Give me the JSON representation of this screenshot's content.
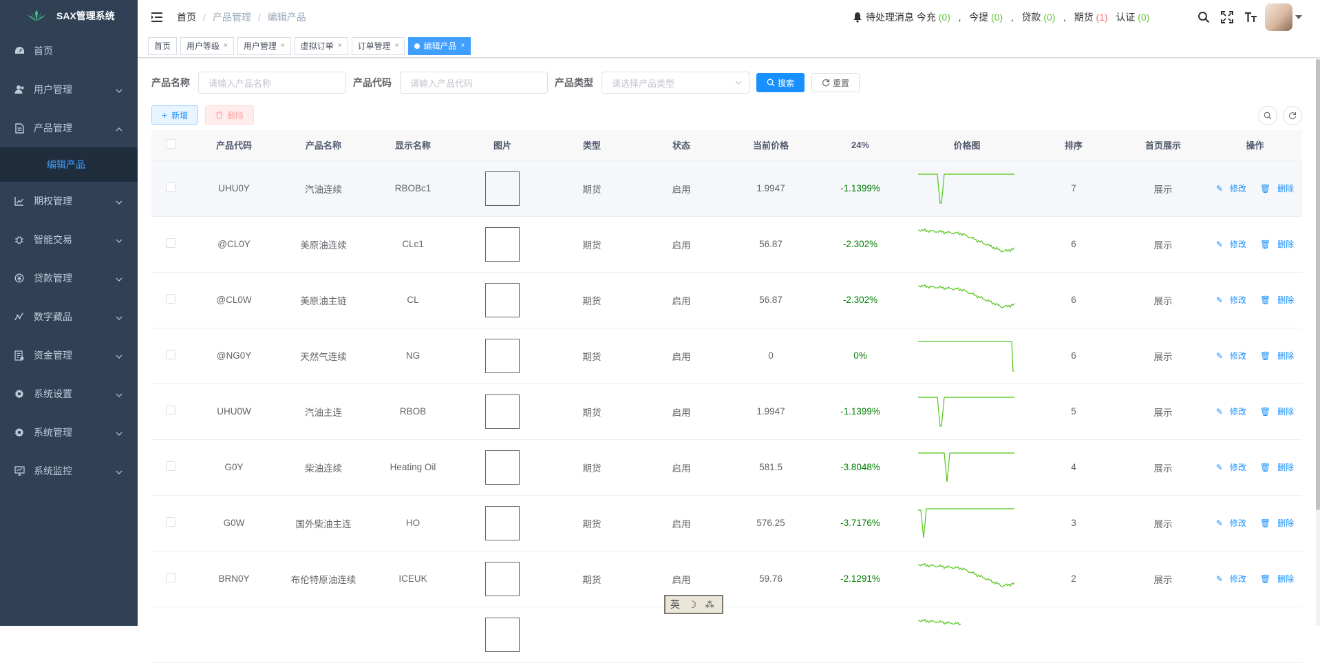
{
  "app": {
    "title": "SAX管理系统"
  },
  "sidebar": {
    "items": [
      {
        "label": "首页",
        "icon": "dashboard-icon"
      },
      {
        "label": "用户管理",
        "icon": "user-icon"
      },
      {
        "label": "产品管理",
        "icon": "document-icon",
        "expanded": true
      },
      {
        "label": "期权管理",
        "icon": "chart-icon"
      },
      {
        "label": "智能交易",
        "icon": "bug-icon"
      },
      {
        "label": "贷款管理",
        "icon": "money-icon"
      },
      {
        "label": "数字藏品",
        "icon": "trend-icon"
      },
      {
        "label": "资金管理",
        "icon": "ledger-icon"
      },
      {
        "label": "系统设置",
        "icon": "gear-icon"
      },
      {
        "label": "系统管理",
        "icon": "gear-icon"
      },
      {
        "label": "系统监控",
        "icon": "monitor-icon"
      }
    ],
    "sub_item": "编辑产品"
  },
  "navbar": {
    "breadcrumb": [
      "首页",
      "产品管理",
      "编辑产品"
    ],
    "notice": {
      "label": "待处理消息",
      "recharge_label": "今充",
      "recharge_count": "(0)",
      "withdraw_label": "今提",
      "withdraw_count": "(0)",
      "loan_label": "贷款",
      "loan_count": "(0)",
      "futures_label": "期货",
      "futures_count": "(1)",
      "verify_label": "认证",
      "verify_count": "(0)",
      "comma": ","
    }
  },
  "tags": [
    "首页",
    "用户等级",
    "用户管理",
    "虚拟订单",
    "订单管理",
    "编辑产品"
  ],
  "search_form": {
    "name_label": "产品名称",
    "name_placeholder": "请输入产品名称",
    "code_label": "产品代码",
    "code_placeholder": "请输入产品代码",
    "type_label": "产品类型",
    "type_placeholder": "请选择产品类型",
    "search_btn": "搜索",
    "reset_btn": "重置"
  },
  "toolbar": {
    "add_btn": "新增",
    "delete_btn": "删除"
  },
  "table": {
    "columns": [
      "产品代码",
      "产品名称",
      "显示名称",
      "图片",
      "类型",
      "状态",
      "当前价格",
      "24%",
      "价格图",
      "排序",
      "首页展示",
      "操作"
    ],
    "edit_label": "修改",
    "delete_label": "删除",
    "rows": [
      {
        "code": "UHU0Y",
        "name": "汽油连续",
        "display": "RBOBc1",
        "type": "期货",
        "status": "启用",
        "price": "1.9947",
        "change": "-1.1399%",
        "sort": "7",
        "home": "展示",
        "spark": "spike_early"
      },
      {
        "code": "@CL0Y",
        "name": "美原油连续",
        "display": "CLc1",
        "type": "期货",
        "status": "启用",
        "price": "56.87",
        "change": "-2.302%",
        "sort": "6",
        "home": "展示",
        "spark": "decline"
      },
      {
        "code": "@CL0W",
        "name": "美原油主链",
        "display": "CL",
        "type": "期货",
        "status": "启用",
        "price": "56.87",
        "change": "-2.302%",
        "sort": "6",
        "home": "展示",
        "spark": "decline"
      },
      {
        "code": "@NG0Y",
        "name": "天然气连续",
        "display": "NG",
        "type": "期货",
        "status": "启用",
        "price": "0",
        "change": "0%",
        "sort": "6",
        "home": "展示",
        "spark": "drop_end"
      },
      {
        "code": "UHU0W",
        "name": "汽油主连",
        "display": "RBOB",
        "type": "期货",
        "status": "启用",
        "price": "1.9947",
        "change": "-1.1399%",
        "sort": "5",
        "home": "展示",
        "spark": "spike_early"
      },
      {
        "code": "G0Y",
        "name": "柴油连续",
        "display": "Heating Oil",
        "type": "期货",
        "status": "启用",
        "price": "581.5",
        "change": "-3.8048%",
        "sort": "4",
        "home": "展示",
        "spark": "spike_mid"
      },
      {
        "code": "G0W",
        "name": "国外柴油主连",
        "display": "HO",
        "type": "期货",
        "status": "启用",
        "price": "576.25",
        "change": "-3.7176%",
        "sort": "3",
        "home": "展示",
        "spark": "spike_start"
      },
      {
        "code": "BRN0Y",
        "name": "布伦特原油连续",
        "display": "ICEUK",
        "type": "期货",
        "status": "启用",
        "price": "59.76",
        "change": "-2.1291%",
        "sort": "2",
        "home": "展示",
        "spark": "decline"
      },
      {
        "code": "",
        "name": "",
        "display": "",
        "type": "",
        "status": "",
        "price": "",
        "change": "",
        "sort": "",
        "home": "",
        "spark": "decline_partial"
      }
    ]
  },
  "ime": {
    "text": "英 ☽ ⁂"
  },
  "colors": {
    "sidebar_bg": "#304156",
    "accent": "#409eff",
    "positive": "#008000",
    "spark": "#52c41a"
  }
}
